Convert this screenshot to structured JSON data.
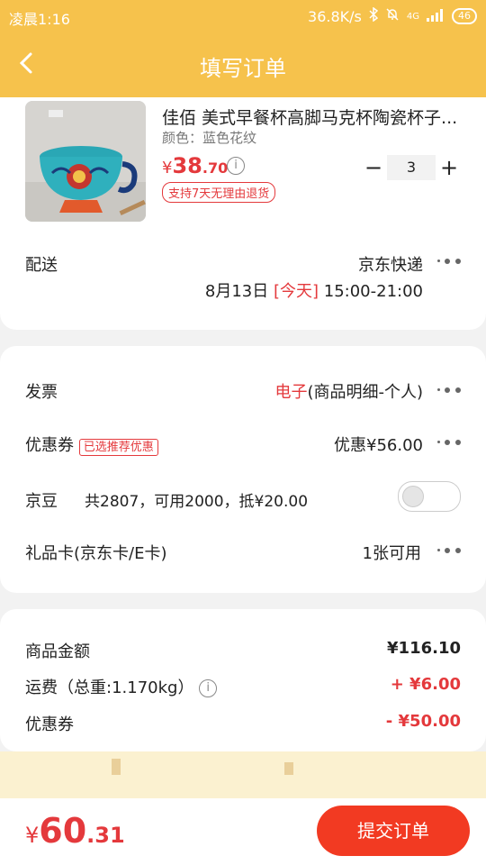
{
  "status_bar": {
    "time": "凌晨1:16",
    "network_speed": "36.8K/s",
    "network_type": "4G",
    "battery": "46"
  },
  "header": {
    "title": "填写订单"
  },
  "product": {
    "name": "佳佰 美式早餐杯高脚马克杯陶瓷杯子...",
    "color_label": "颜色：蓝色花纹",
    "price_currency": "¥",
    "price_int": "38",
    "price_dec": ".70",
    "return_badge": "支持7天无理由退货",
    "quantity": "3",
    "minus": "−",
    "plus": "+"
  },
  "delivery": {
    "label": "配送",
    "carrier": "京东快递",
    "date": "8月13日",
    "today": "[今天]",
    "time_range": "15:00-21:00"
  },
  "invoice": {
    "label": "发票",
    "value_red": "电子",
    "value_rest": "(商品明细-个人)"
  },
  "coupon": {
    "label": "优惠券",
    "tag": "已选推荐优惠",
    "value": "优惠¥56.00"
  },
  "jingdou": {
    "label": "京豆",
    "value": "共2807，可用2000，抵¥20.00",
    "enabled": false
  },
  "gift_card": {
    "label": "礼品卡(京东卡/E卡)",
    "value": "1张可用"
  },
  "summary": {
    "goods_label": "商品金额",
    "goods_value": "¥116.10",
    "freight_label": "运费（总重:1.170kg）",
    "freight_value": "+ ¥6.00",
    "coupon_label": "优惠券",
    "coupon_value": "- ¥50.00"
  },
  "footer": {
    "total_currency": "¥",
    "total_int": "60",
    "total_dec": ".31",
    "submit_label": "提交订单"
  },
  "colors": {
    "header": "#f6c24c",
    "accent_red": "#e4393c",
    "submit_button": "#f23a22"
  }
}
